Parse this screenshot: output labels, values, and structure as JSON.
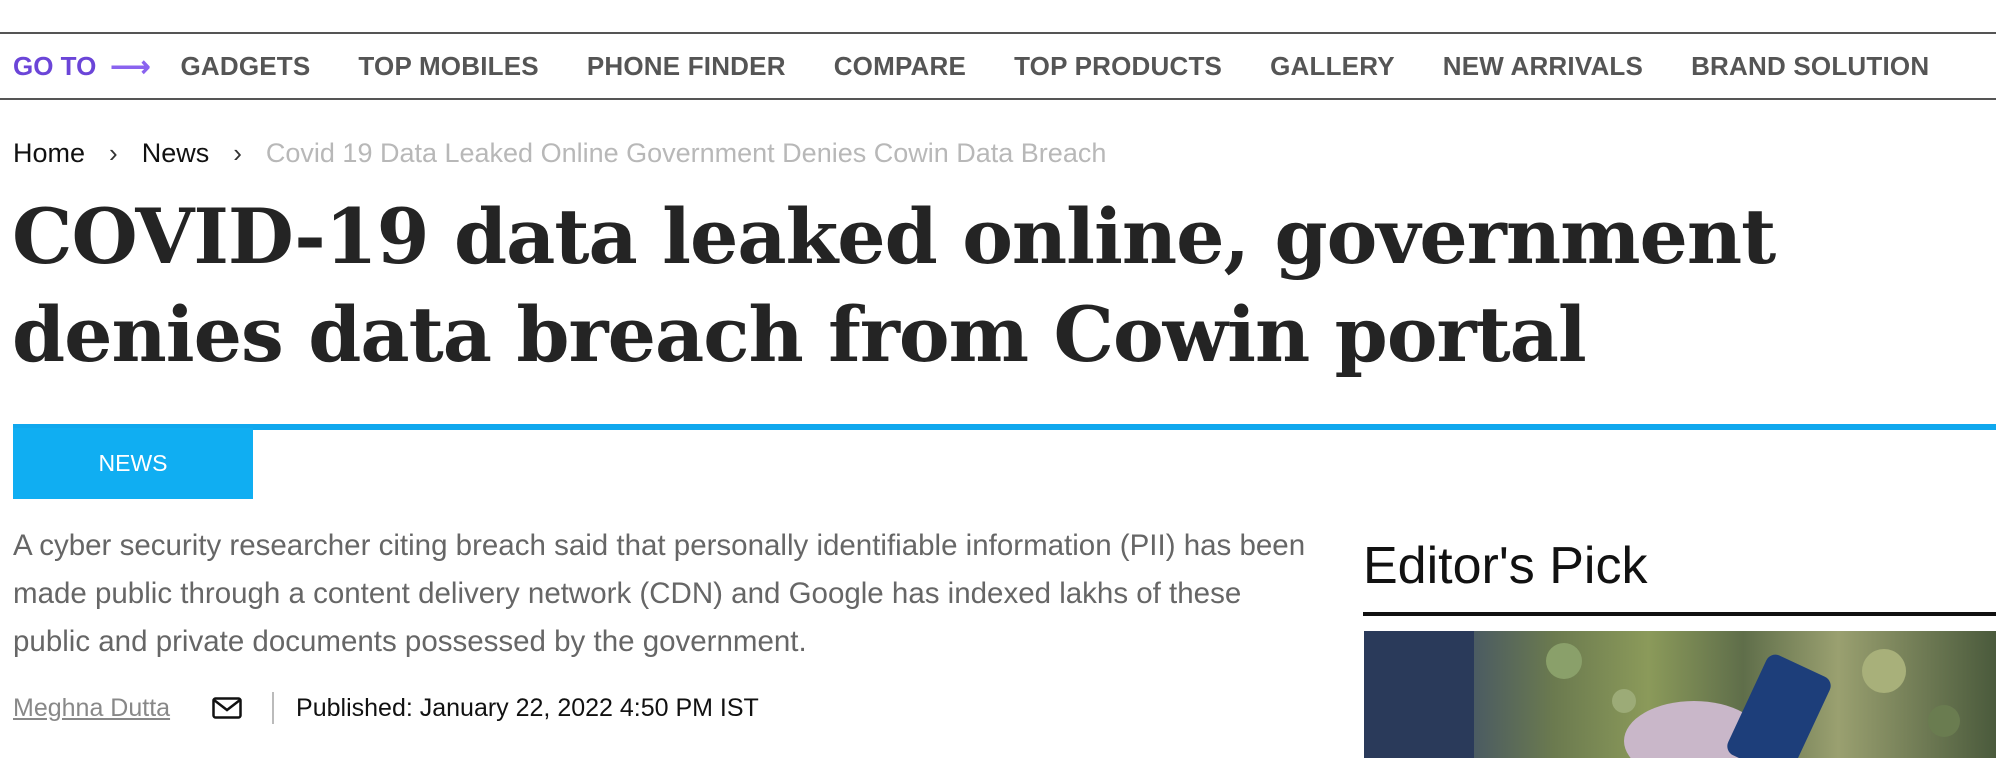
{
  "topnav": {
    "goto_label": "GO TO",
    "links": [
      "GADGETS",
      "TOP MOBILES",
      "PHONE FINDER",
      "COMPARE",
      "TOP PRODUCTS",
      "GALLERY",
      "NEW ARRIVALS",
      "BRAND SOLUTION"
    ]
  },
  "breadcrumb": {
    "home": "Home",
    "news": "News",
    "current": "Covid 19 Data Leaked Online Government Denies Cowin Data Breach"
  },
  "article": {
    "headline": "COVID-19 data leaked online, government denies data breach from Cowin portal",
    "category": "NEWS",
    "summary": "A cyber security researcher citing breach said that personally identifiable information (PII) has been made public through a content delivery network (CDN) and Google has indexed lakhs of these public and private documents possessed by the government.",
    "author": "Meghna Dutta",
    "published": "Published: January 22, 2022 4:50 PM IST"
  },
  "sidebar": {
    "title": "Editor's Pick"
  },
  "colors": {
    "accent": "#10aef2",
    "goto": "#6b45d8"
  }
}
